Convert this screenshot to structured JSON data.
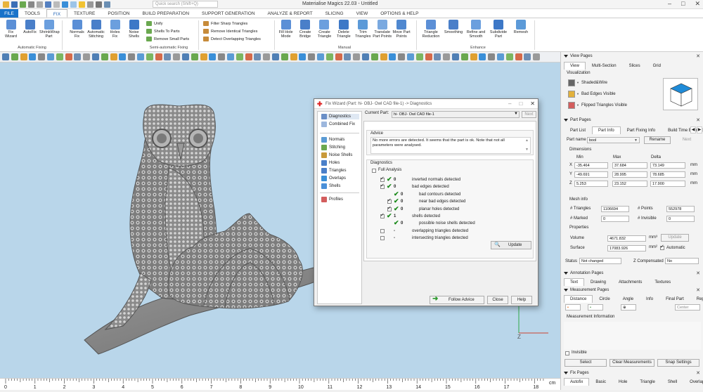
{
  "app": {
    "title": "Materialise Magics 22.03 - Untitled",
    "search_placeholder": "Quick search (Shift+Q)"
  },
  "tabs": [
    "FILE",
    "TOOLS",
    "FIX",
    "TEXTURE",
    "POSITION",
    "BUILD PREPARATION",
    "SUPPORT GENERATION",
    "ANALYZE & REPORT",
    "SLICING",
    "VIEW",
    "OPTIONS & HELP"
  ],
  "ribbon": {
    "auto": [
      {
        "l": "Fix\nWizard"
      },
      {
        "l": "AutoFix"
      },
      {
        "l": "ShrinkWrap\nPart"
      }
    ],
    "auto_group": "Automatic Fixing",
    "semi": [
      {
        "l": "Normals\nFix"
      },
      {
        "l": "Automatic\nStitching"
      },
      {
        "l": "Holes\nFix"
      },
      {
        "l": "Noise\nShells"
      }
    ],
    "semi_small": [
      "Unify",
      "Shells To Parts",
      "Remove Small Parts"
    ],
    "semi_group": "Semi-automatic Fixing",
    "filter": [
      "Filter Sharp Triangles",
      "Remove Identical Triangles",
      "Detect Overlapping Triangles"
    ],
    "manual": [
      {
        "l": "Fill Hole\nMode"
      },
      {
        "l": "Create\nBridge"
      },
      {
        "l": "Create\nTriangle"
      },
      {
        "l": "Delete\nTriangle"
      },
      {
        "l": "Trim\nTriangles"
      },
      {
        "l": "Translate\nPart Points"
      },
      {
        "l": "Move Part\nPoints"
      }
    ],
    "manual_group": "Manual",
    "enhance": [
      {
        "l": "Triangle\nReduction"
      },
      {
        "l": "Smoothing"
      },
      {
        "l": "Refine and\nSmooth"
      },
      {
        "l": "Subdivide\nPart"
      },
      {
        "l": "Remesh"
      }
    ],
    "enhance_group": "Enhance"
  },
  "dialog": {
    "title": "Fix Wizard (Part: hi- OBJ- Owl CAD file-1) -> Diagnostics",
    "current_part_label": "Current Part:",
    "current_part": "hi- OBJ- Owl CAD file-1",
    "next": "Next",
    "nav": [
      "Diagnostics",
      "Combined Fix",
      "Normals",
      "Stitching",
      "Noise Shells",
      "Holes",
      "Triangles",
      "Overlaps",
      "Shells",
      "Profiles"
    ],
    "advice_title": "Advice",
    "advice": "No more errors are detected. It seems that the part is ok. Note that not all parameters were analysed.",
    "diag_title": "Diagnostics",
    "full_analysis": "Full Analysis",
    "rows": [
      {
        "label": "inverted normals detected",
        "val": "0",
        "checked": true,
        "ok": true,
        "indent": 0
      },
      {
        "label": "bad edges detected",
        "val": "0",
        "checked": true,
        "ok": true,
        "indent": 0
      },
      {
        "label": "bad contours detected",
        "val": "0",
        "checked": false,
        "ok": true,
        "indent": 1,
        "nocb": true
      },
      {
        "label": "near bad edges detected",
        "val": "0",
        "checked": true,
        "ok": true,
        "indent": 1
      },
      {
        "label": "planar holes detected",
        "val": "0",
        "checked": true,
        "ok": true,
        "indent": 1
      },
      {
        "label": "shells detected",
        "val": "1",
        "checked": true,
        "ok": true,
        "indent": 0
      },
      {
        "label": "possible noise shells detected",
        "val": "0",
        "checked": false,
        "ok": true,
        "indent": 1,
        "nocb": true
      },
      {
        "label": "overlapping triangles detected",
        "val": "-",
        "checked": false,
        "ok": false,
        "indent": 0
      },
      {
        "label": "intersecting triangles detected",
        "val": "-",
        "checked": false,
        "ok": false,
        "indent": 0
      }
    ],
    "update": "Update",
    "follow": "Follow Advice",
    "close": "Close",
    "help": "Help"
  },
  "right": {
    "view_pages": "View Pages",
    "view_tabs": [
      "View",
      "Multi-Section",
      "Slices",
      "Grid"
    ],
    "visualization": "Visualization",
    "vis": [
      "Shaded&Wire",
      "Bad Edges Visible",
      "Flipped Triangles Visible"
    ],
    "part_pages": "Part Pages",
    "part_tabs": [
      "Part List",
      "Part Info",
      "Part Fixing Info",
      "Build Time Estimation"
    ],
    "part_name_label": "Part name",
    "part_name": "bool",
    "rename": "Rename",
    "next": "Next",
    "dimensions": "Dimensions",
    "dim_head": [
      "Min",
      "Max",
      "Delta"
    ],
    "dims": [
      {
        "axis": "X",
        "min": "-35.464",
        "max": "37.684",
        "delta": "73.149",
        "unit": "mm"
      },
      {
        "axis": "Y",
        "min": "-49.691",
        "max": "28.995",
        "delta": "78.685",
        "unit": "mm"
      },
      {
        "axis": "Z",
        "min": "5.253",
        "max": "23.152",
        "delta": "17.900",
        "unit": "mm"
      }
    ],
    "mesh_info": "Mesh info",
    "triangles_label": "# Triangles",
    "triangles": "1106694",
    "points_label": "# Points",
    "points": "552978",
    "marked_label": "# Marked",
    "marked": "0",
    "invisible_label": "# Invisible",
    "invisible": "0",
    "properties": "Properties",
    "volume_label": "Volume",
    "volume": "4671.832",
    "vol_unit": "mm³",
    "surface_label": "Surface",
    "surface": "17083.926",
    "surf_unit": "mm²",
    "automatic": "Automatic",
    "update": "Update",
    "status_label": "Status",
    "status": "Not changed",
    "zcomp_label": "Z Compensated",
    "zcomp": "No",
    "annotation_pages": "Annotation Pages",
    "ann_tabs": [
      "Text",
      "Drawing",
      "Attachments",
      "Textures"
    ],
    "measurement_pages": "Measurement Pages",
    "meas_tabs": [
      "Distance",
      "Circle",
      "Angle",
      "Info",
      "Final Part",
      "Report"
    ],
    "center": "Center",
    "meas_info": "Measurement Information",
    "invisible_cb": "Invisible",
    "select": "Select",
    "clear": "Clear Measurements",
    "snap": "Snap Settings",
    "fix_pages": "Fix Pages",
    "fix_tabs": [
      "Autofix",
      "Basic",
      "Hole",
      "Triangle",
      "Shell",
      "Overlap"
    ]
  },
  "ruler": {
    "ticks": [
      "0",
      "1",
      "2",
      "3",
      "4",
      "5",
      "6",
      "7",
      "8",
      "9",
      "10",
      "11",
      "12",
      "13",
      "14",
      "15",
      "16",
      "17",
      "18"
    ],
    "unit": "cm"
  },
  "axis": {
    "z": "Z"
  }
}
